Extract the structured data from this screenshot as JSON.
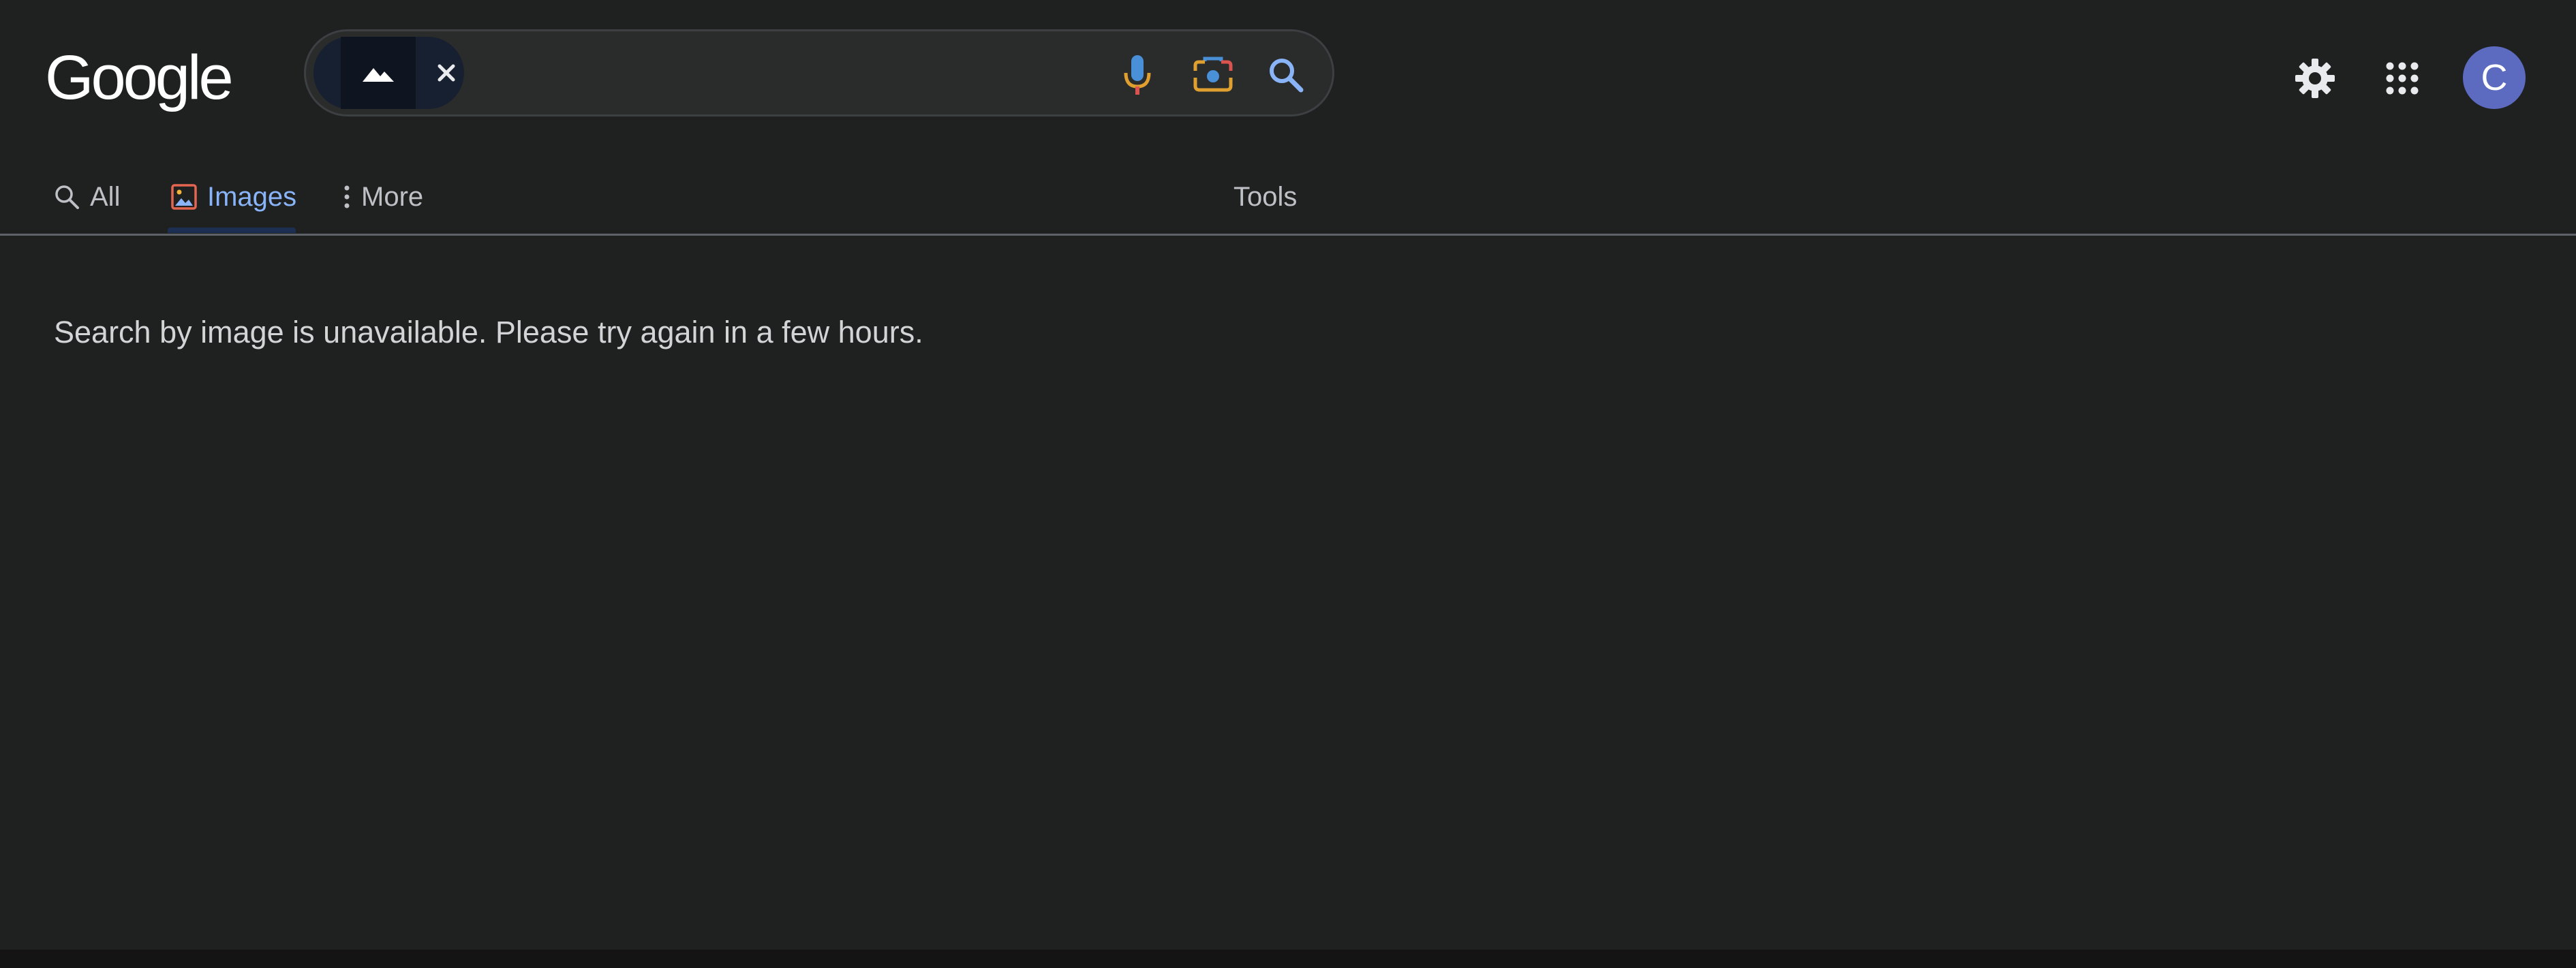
{
  "header": {
    "logo_text": "Google",
    "avatar_letter": "C"
  },
  "icons": {
    "image_chip": "mountain-icon",
    "chip_close": "close-icon",
    "voice": "mic-icon",
    "lens": "camera-lens-icon",
    "search": "search-icon",
    "settings": "gear-icon",
    "apps": "apps-grid-icon"
  },
  "tabs": [
    {
      "label": "All",
      "icon": "search-icon"
    },
    {
      "label": "Images",
      "icon": "image-icon",
      "active": true
    },
    {
      "label": "More",
      "icon": "more-vert-icon"
    }
  ],
  "tools_label": "Tools",
  "message": "Search by image is unavailable. Please try again in a few hours.",
  "colors": {
    "background": "#1f2020",
    "active_tab": "#8ab4f8",
    "avatar": "#5c6bc0"
  }
}
